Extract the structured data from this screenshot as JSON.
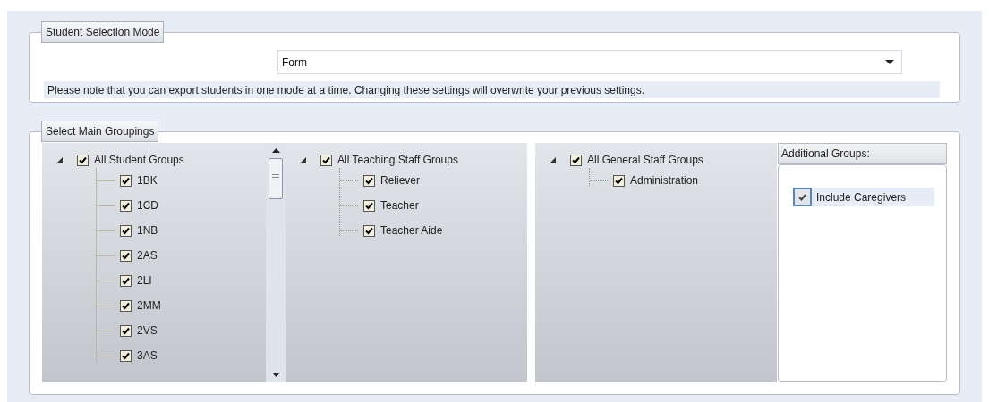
{
  "selection_mode": {
    "legend": "Student Selection Mode",
    "dropdown": {
      "value": "Form"
    },
    "note": "Please note that you can export students in one mode at a time. Changing these settings will overwrite your previous settings."
  },
  "main_groupings": {
    "legend": "Select Main Groupings",
    "trees": [
      {
        "scrollable": true,
        "kind": "solid",
        "root": {
          "label": "All Student Groups",
          "checked": true,
          "expanded": true,
          "children": [
            {
              "label": "1BK",
              "checked": true
            },
            {
              "label": "1CD",
              "checked": true
            },
            {
              "label": "1NB",
              "checked": true
            },
            {
              "label": "2AS",
              "checked": true
            },
            {
              "label": "2LI",
              "checked": true
            },
            {
              "label": "2MM",
              "checked": true
            },
            {
              "label": "2VS",
              "checked": true
            },
            {
              "label": "3AS",
              "checked": true
            }
          ]
        }
      },
      {
        "scrollable": false,
        "kind": "dotted",
        "root": {
          "label": "All Teaching Staff Groups",
          "checked": true,
          "expanded": true,
          "children": [
            {
              "label": "Reliever",
              "checked": true
            },
            {
              "label": "Teacher",
              "checked": true
            },
            {
              "label": "Teacher Aide",
              "checked": true
            }
          ]
        }
      },
      {
        "scrollable": false,
        "kind": "dotted",
        "root": {
          "label": "All General Staff Groups",
          "checked": true,
          "expanded": true,
          "children": [
            {
              "label": "Administration",
              "checked": true
            }
          ]
        }
      }
    ],
    "additional": {
      "title": "Additional Groups:",
      "options": [
        {
          "label": "Include Caregivers",
          "checked": true
        }
      ]
    }
  }
}
